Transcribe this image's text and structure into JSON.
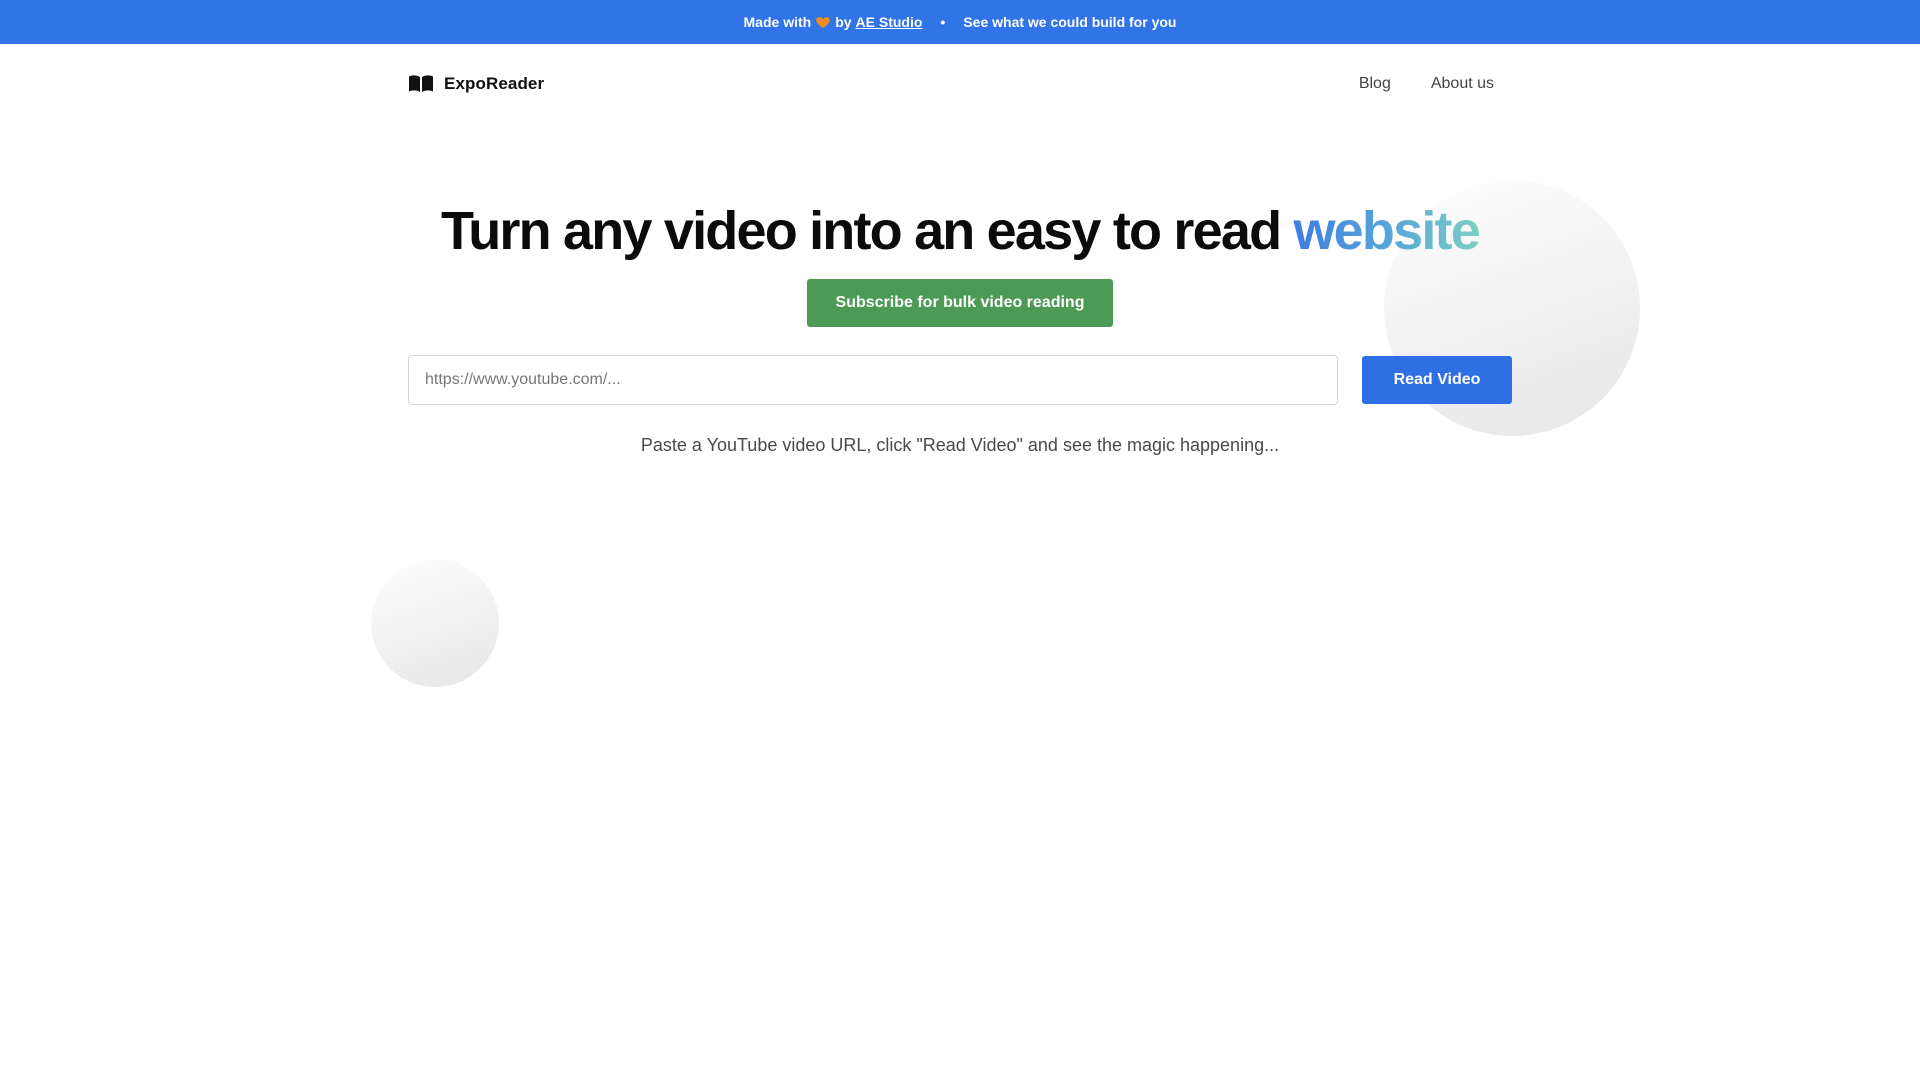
{
  "banner": {
    "made_with": "Made with",
    "heart_icon": "orange-heart-icon",
    "by": "by",
    "studio_link": "AE Studio",
    "separator": "•",
    "cta": "See what we could build for you",
    "background_color": "#3174e8"
  },
  "nav": {
    "logo_icon": "open-book-icon",
    "brand": "ExpoReader",
    "links": [
      "Blog",
      "About us"
    ]
  },
  "hero": {
    "headline_main": "Turn any video into an easy to read",
    "headline_accent": "website",
    "subscribe_label": "Subscribe for bulk video reading",
    "subscribe_color": "#4c9a55"
  },
  "form": {
    "url_placeholder": "https://www.youtube.com/...",
    "url_value": "",
    "submit_label": "Read Video",
    "submit_color": "#2f6fe4"
  },
  "hint": "Paste a YouTube video URL, click \"Read Video\" and see the magic happening..."
}
